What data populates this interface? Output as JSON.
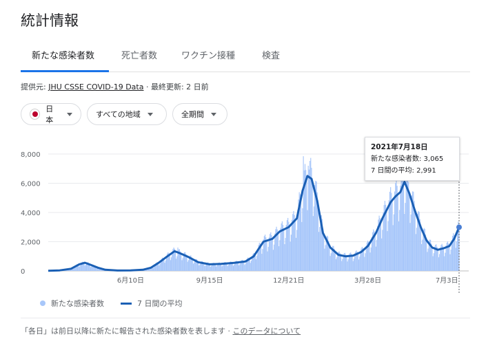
{
  "header": {
    "title": "統計情報"
  },
  "tabs": [
    {
      "label": "新たな感染者数",
      "active": true
    },
    {
      "label": "死亡者数"
    },
    {
      "label": "ワクチン接種"
    },
    {
      "label": "検査"
    }
  ],
  "source": {
    "prefix": "提供元: ",
    "link": "JHU CSSE COVID-19 Data",
    "updated": " · 最終更新: 2 日前"
  },
  "filters": {
    "country": "日本",
    "region": "すべての地域",
    "period": "全期間"
  },
  "tooltip": {
    "date": "2021年7月18日",
    "new_cases": "新たな感染者数: 3,065",
    "avg7": "7 日間の平均: 2,991"
  },
  "legend": {
    "daily": "新たな感染者数",
    "average": "7 日間の平均"
  },
  "footnote": {
    "text": "「各日」は前日以降に新たに報告された感染者数を表します · ",
    "link": "このデータについて"
  },
  "colors": {
    "accent": "#1a73e8",
    "bars": "#a8c7fa",
    "avg_line": "#1a5fb4"
  },
  "chart_data": {
    "type": "area",
    "x_start": "2020-03-01",
    "x_end": "2021-07-18",
    "ylim": [
      0,
      8000
    ],
    "y_ticks": [
      0,
      2000,
      4000,
      6000,
      8000
    ],
    "y_tick_labels": [
      "0",
      "2,000",
      "4,000",
      "6,000",
      "8,000"
    ],
    "x_tick_labels": [
      "6月10日",
      "9月15日",
      "12月21日",
      "3月28日",
      "7月3日"
    ],
    "x_tick_dates": [
      "2020-06-10",
      "2020-09-15",
      "2020-12-21",
      "2021-03-28",
      "2021-07-03"
    ],
    "series": [
      {
        "name": "7 日間の平均",
        "points": [
          [
            "2020-03-01",
            10
          ],
          [
            "2020-03-15",
            40
          ],
          [
            "2020-03-29",
            150
          ],
          [
            "2020-04-08",
            450
          ],
          [
            "2020-04-15",
            560
          ],
          [
            "2020-04-22",
            420
          ],
          [
            "2020-05-01",
            220
          ],
          [
            "2020-05-10",
            80
          ],
          [
            "2020-05-25",
            30
          ],
          [
            "2020-06-10",
            40
          ],
          [
            "2020-06-25",
            80
          ],
          [
            "2020-07-05",
            220
          ],
          [
            "2020-07-15",
            580
          ],
          [
            "2020-07-25",
            1000
          ],
          [
            "2020-08-03",
            1350
          ],
          [
            "2020-08-10",
            1200
          ],
          [
            "2020-08-20",
            950
          ],
          [
            "2020-09-01",
            600
          ],
          [
            "2020-09-15",
            450
          ],
          [
            "2020-09-29",
            480
          ],
          [
            "2020-10-15",
            550
          ],
          [
            "2020-10-29",
            650
          ],
          [
            "2020-11-08",
            1000
          ],
          [
            "2020-11-20",
            2000
          ],
          [
            "2020-12-01",
            2200
          ],
          [
            "2020-12-10",
            2700
          ],
          [
            "2020-12-21",
            3000
          ],
          [
            "2020-12-31",
            3600
          ],
          [
            "2021-01-07",
            5500
          ],
          [
            "2021-01-13",
            6500
          ],
          [
            "2021-01-18",
            6300
          ],
          [
            "2021-01-25",
            4800
          ],
          [
            "2021-02-01",
            2600
          ],
          [
            "2021-02-10",
            1600
          ],
          [
            "2021-02-20",
            1100
          ],
          [
            "2021-03-01",
            1000
          ],
          [
            "2021-03-10",
            1050
          ],
          [
            "2021-03-20",
            1300
          ],
          [
            "2021-03-28",
            1700
          ],
          [
            "2021-04-07",
            2600
          ],
          [
            "2021-04-15",
            3600
          ],
          [
            "2021-04-25",
            4700
          ],
          [
            "2021-05-01",
            5100
          ],
          [
            "2021-05-07",
            5400
          ],
          [
            "2021-05-12",
            6100
          ],
          [
            "2021-05-18",
            5300
          ],
          [
            "2021-05-25",
            4100
          ],
          [
            "2021-06-01",
            3000
          ],
          [
            "2021-06-08",
            2100
          ],
          [
            "2021-06-15",
            1600
          ],
          [
            "2021-06-22",
            1450
          ],
          [
            "2021-06-29",
            1550
          ],
          [
            "2021-07-06",
            1700
          ],
          [
            "2021-07-12",
            2200
          ],
          [
            "2021-07-18",
            2991
          ]
        ]
      }
    ],
    "daily_highlights": [
      [
        "2020-08-07",
        1600
      ],
      [
        "2021-01-08",
        7850
      ],
      [
        "2021-01-14",
        7200
      ],
      [
        "2021-05-08",
        7200
      ],
      [
        "2021-05-14",
        6800
      ],
      [
        "2021-07-18",
        3065
      ]
    ],
    "selected": {
      "date": "2021-07-18",
      "value": 2991
    }
  }
}
